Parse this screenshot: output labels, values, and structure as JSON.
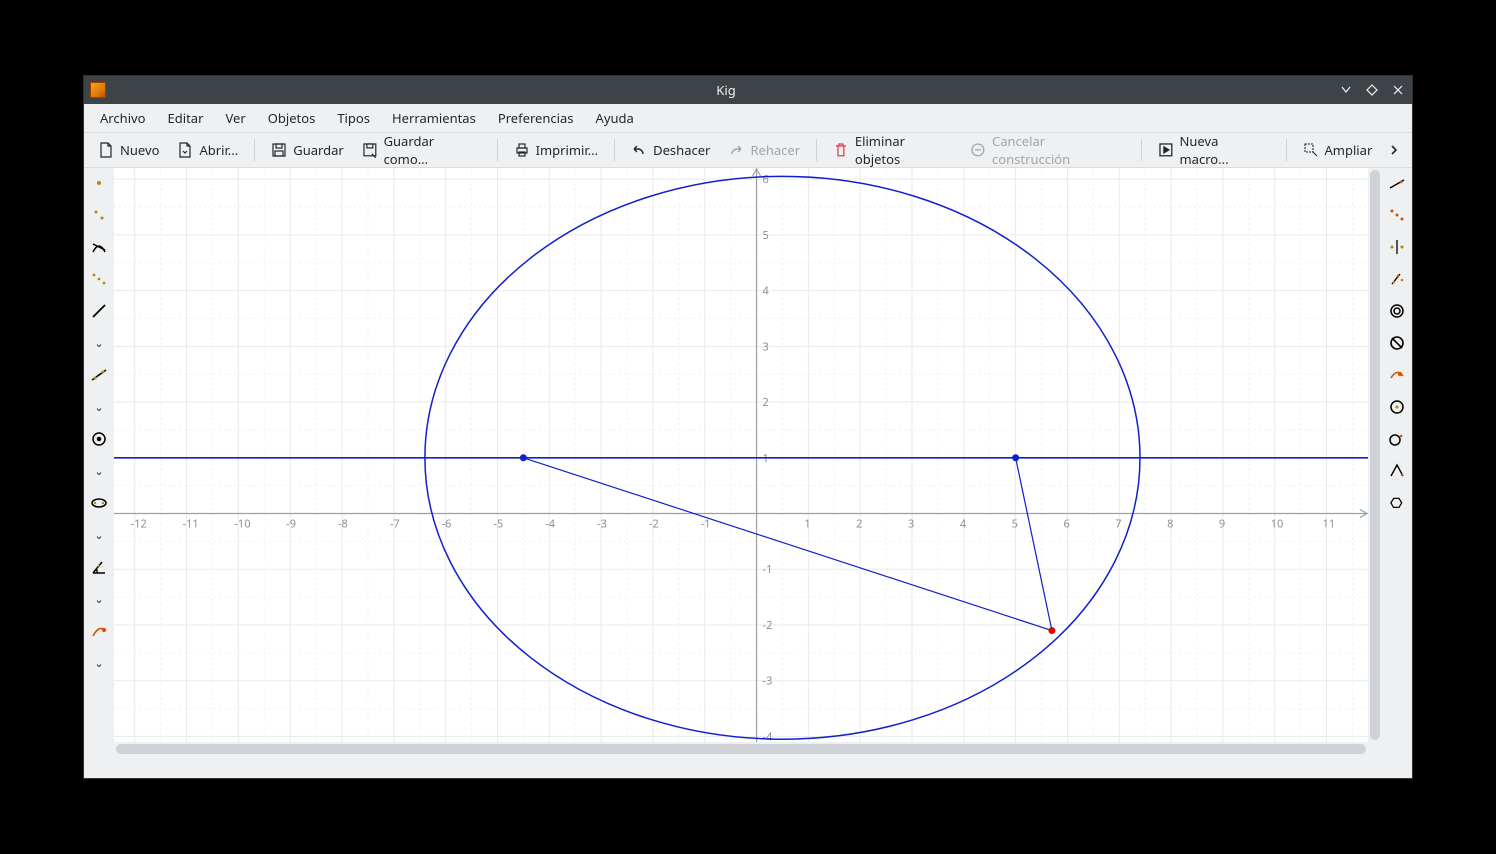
{
  "title": "Kig",
  "menus": {
    "file": "Archivo",
    "edit": "Editar",
    "view": "Ver",
    "objects": "Objetos",
    "types": "Tipos",
    "tools": "Herramientas",
    "prefs": "Preferencias",
    "help": "Ayuda"
  },
  "toolbar": {
    "new": "Nuevo",
    "open": "Abrir...",
    "save": "Guardar",
    "saveas": "Guardar como...",
    "print": "Imprimir...",
    "undo": "Deshacer",
    "redo": "Rehacer",
    "delete": "Eliminar objetos",
    "cancel": "Cancelar construcción",
    "macro": "Nueva macro...",
    "zoom": "Ampliar"
  },
  "chart_data": {
    "type": "geometry",
    "x_ticks": [
      -12,
      -11,
      -10,
      -9,
      -8,
      -7,
      -6,
      -5,
      -4,
      -3,
      -2,
      -1,
      1,
      2,
      3,
      4,
      5,
      6,
      7,
      8,
      9,
      10,
      11
    ],
    "y_ticks": [
      6,
      5,
      4,
      3,
      2,
      1,
      -1,
      -2,
      -3,
      -4
    ],
    "x_range": [
      -12.4,
      11.8
    ],
    "y_range": [
      -4.1,
      6.2
    ],
    "ellipse": {
      "cx": 0.5,
      "cy": 1.0,
      "rx": 6.9,
      "ry": 5.05
    },
    "horizontal_line_y": 1.0,
    "focus_points": [
      {
        "x": -4.5,
        "y": 1.0,
        "color": "blue"
      },
      {
        "x": 5.0,
        "y": 1.0,
        "color": "blue"
      }
    ],
    "third_point": {
      "x": 5.7,
      "y": -2.1,
      "color": "red"
    },
    "segments": [
      {
        "from": [
          -4.5,
          1.0
        ],
        "to": [
          5.7,
          -2.1
        ]
      },
      {
        "from": [
          5.0,
          1.0
        ],
        "to": [
          5.7,
          -2.1
        ]
      }
    ]
  }
}
